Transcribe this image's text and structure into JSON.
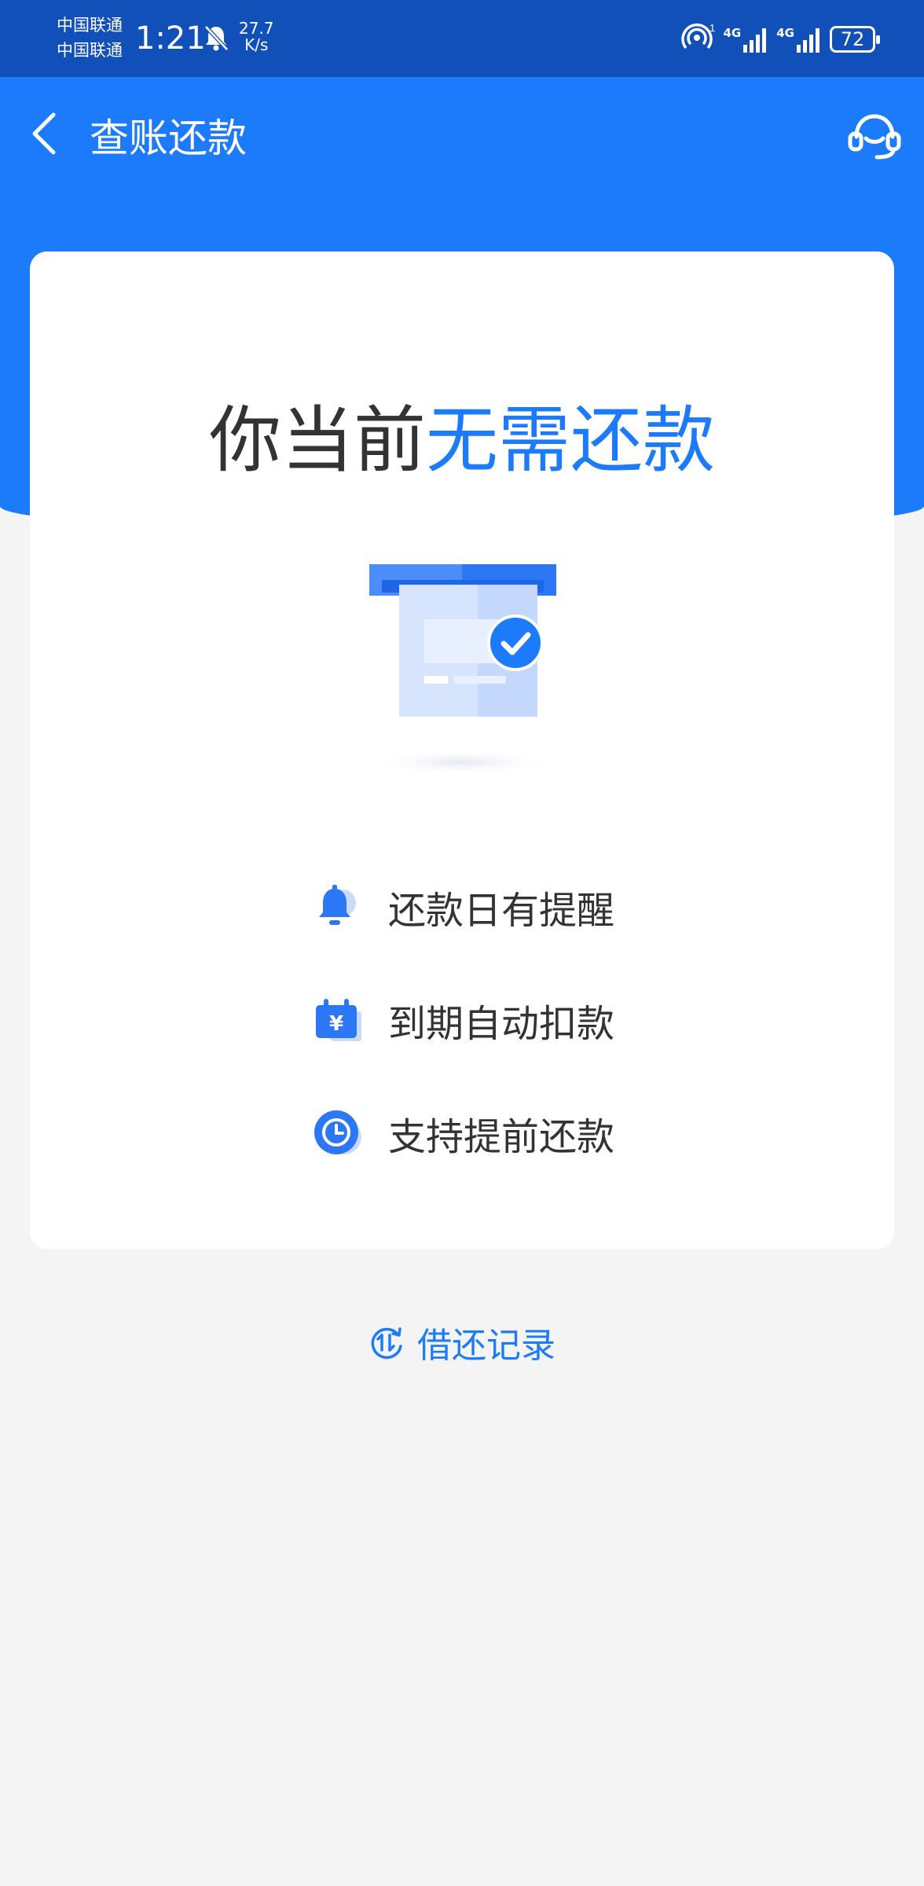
{
  "status_bar": {
    "carrier_1": "中国联通",
    "carrier_2": "中国联通",
    "time": "1:21",
    "speed_value": "27.7",
    "speed_unit": "K/s",
    "network_1": "4G",
    "network_2": "4G",
    "battery": "72"
  },
  "header": {
    "title": "查账还款",
    "back_icon": "chevron-left-icon",
    "service_icon": "headset-icon"
  },
  "card": {
    "headline_normal": "你当前",
    "headline_highlight": "无需还款",
    "features": [
      {
        "icon": "bell-icon",
        "label": "还款日有提醒"
      },
      {
        "icon": "calendar-yuan-icon",
        "label": "到期自动扣款"
      },
      {
        "icon": "clock-icon",
        "label": "支持提前还款"
      }
    ]
  },
  "footer": {
    "record_label": "借还记录",
    "record_icon": "history-icon"
  },
  "colors": {
    "status_bar": "#1150b8",
    "primary": "#1b7bfb",
    "background": "#f4f4f4"
  }
}
